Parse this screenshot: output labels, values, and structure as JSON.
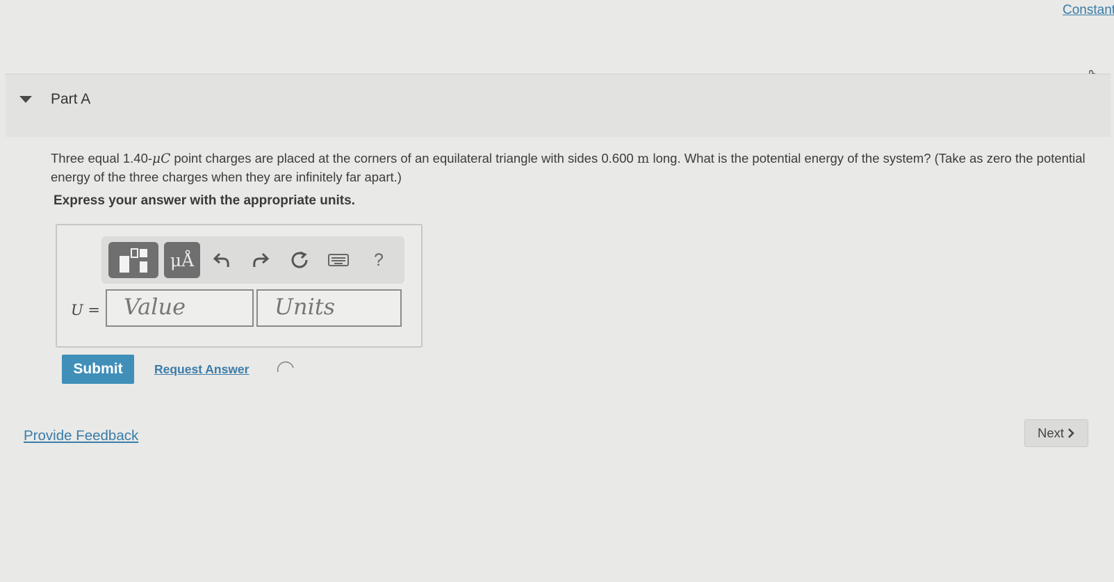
{
  "header": {
    "constants_link": "Constants"
  },
  "part": {
    "title": "Part A"
  },
  "question": {
    "text_1": "Three equal 1.40-",
    "charge_unit": "μC",
    "text_2": " point charges are placed at the corners of an equilateral triangle with sides 0.600 ",
    "length_unit": "m",
    "text_3": " long. What is the potential energy of the system? (Take as zero the potential energy of the three charges when they are infinitely far apart.)",
    "instruction": "Express your answer with the appropriate units."
  },
  "toolbar": {
    "templates_icon": "templates-icon",
    "units_label": "μÅ",
    "undo_icon": "undo-icon",
    "redo_icon": "redo-icon",
    "reset_icon": "reset-icon",
    "keyboard_icon": "keyboard-icon",
    "help_label": "?"
  },
  "answer": {
    "variable": "U",
    "equals": " =",
    "value_placeholder": "Value",
    "units_placeholder": "Units"
  },
  "actions": {
    "submit_label": "Submit",
    "request_answer_label": "Request Answer"
  },
  "footer": {
    "feedback_label": "Provide Feedback",
    "next_label": "Next"
  }
}
